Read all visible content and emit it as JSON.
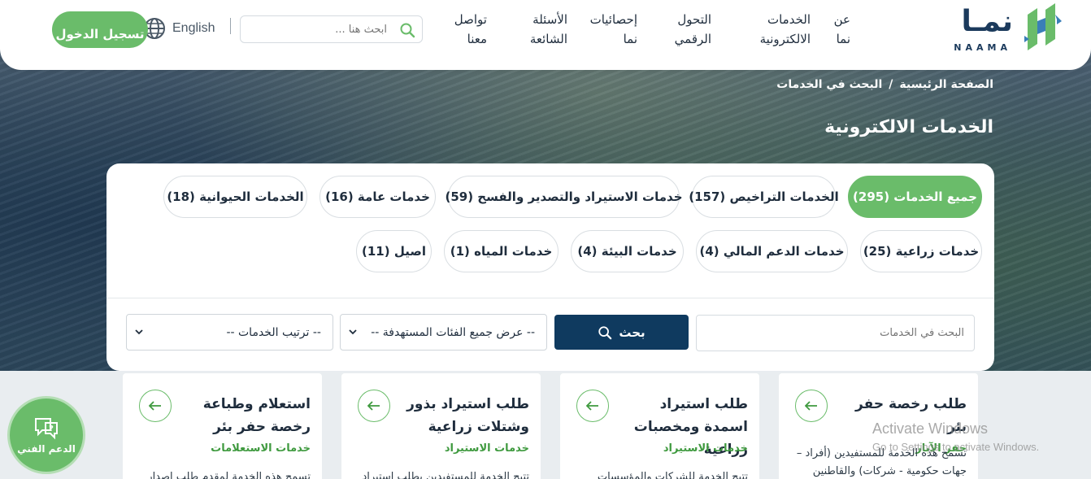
{
  "brand": {
    "name_ar": "نمـا",
    "name_en": "NAAMA"
  },
  "nav": [
    {
      "line1": "عن",
      "line2": "نما"
    },
    {
      "line1": "الخدمات",
      "line2": "الالكترونية"
    },
    {
      "line1": "التحول",
      "line2": "الرقمي"
    },
    {
      "line1": "إحصائيات",
      "line2": "نما"
    },
    {
      "line1": "الأسئلة",
      "line2": "الشائعة"
    },
    {
      "line1": "تواصل",
      "line2": "معنا"
    }
  ],
  "header": {
    "search_placeholder": "ابحث هنا ...",
    "language": "English",
    "login_label": "تسجيل الدخول"
  },
  "breadcrumb": {
    "home": "الصفحة الرئيسية",
    "separator": "/",
    "current": "البحث في الخدمات"
  },
  "page_title": "الخدمات الالكترونية",
  "chips": [
    "جميع الخدمات (295)",
    "الخدمات التراخيص (157)",
    "خدمات الاستيراد والتصدير والفسح (59)",
    "خدمات عامة (16)",
    "الخدمات الحيوانية (18)",
    "خدمات زراعية (25)",
    "خدمات الدعم المالي (4)",
    "خدمات البيئة (4)",
    "خدمات المياه (1)",
    "اصيل (11)"
  ],
  "filters": {
    "search_placeholder": "البحث في الخدمات",
    "search_button": "بحث",
    "category_select": "-- عرض جميع الفئات المستهدفة --",
    "sort_select": "-- ترتيب الخدمات --"
  },
  "cards": [
    {
      "title": "طلب رخصة حفر بئر",
      "category": "حفر الآبار",
      "description": "تسمح هذه الخدمة للمستفيدين (أفراد – جهات حكومية - شركات) والقاطنين"
    },
    {
      "title": "طلب استيراد اسمدة ومخصبات زراعية",
      "category": "خدمات الاستيراد",
      "description": "تتيح الخدمة للشركات والمؤسسات"
    },
    {
      "title": "طلب استيراد بذور وشتلات زراعية",
      "category": "خدمات الاستيراد",
      "description": "تتيح الخدمة للمستفيدين بطلب استيراد"
    },
    {
      "title": "استعلام وطباعة رخصة حفر بئر",
      "category": "خدمات الاستعلامات",
      "description": "تسمح هذه الخدمة لمقدم طلب إصدار"
    }
  ],
  "support_label": "الدعم الفني",
  "watermark": {
    "line1": "Activate Windows",
    "line2": "Go to Settings to activate Windows."
  },
  "colors": {
    "accent_green": "#6abc6a",
    "navy": "#0f3a5f",
    "category_green": "#3f9a3f"
  }
}
